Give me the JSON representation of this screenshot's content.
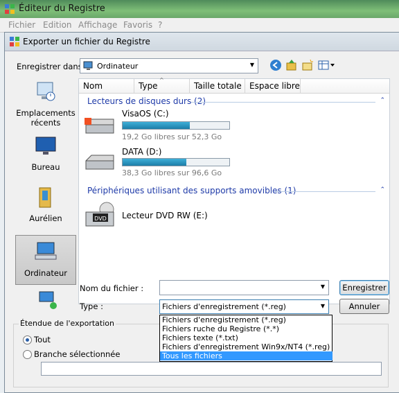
{
  "app": {
    "title": "Éditeur du Registre",
    "menu": [
      "Fichier",
      "Edition",
      "Affichage",
      "Favoris",
      "?"
    ]
  },
  "dialog": {
    "title": "Exporter un fichier du Registre",
    "save_in_label": "Enregistrer dans :",
    "save_in_value": "Ordinateur",
    "places": [
      "Emplacements récents",
      "Bureau",
      "Aurélien",
      "Ordinateur"
    ],
    "selected_place": "Ordinateur",
    "columns": [
      "Nom",
      "Type",
      "Taille totale",
      "Espace libre"
    ],
    "groups": [
      {
        "title": "Lecteurs de disques durs (2)",
        "items": [
          {
            "name": "VisaOS (C:)",
            "detail": "19,2 Go libres sur 52,3 Go",
            "used_fraction": 0.63
          },
          {
            "name": "DATA (D:)",
            "detail": "38,3 Go libres sur 96,6 Go",
            "used_fraction": 0.6
          }
        ]
      },
      {
        "title": "Périphériques utilisant des supports amovibles (1)",
        "items": [
          {
            "name": "Lecteur DVD RW (E:)",
            "icon_text": "DVD"
          }
        ]
      }
    ],
    "filename_label": "Nom du fichier :",
    "filename_value": "",
    "type_label": "Type :",
    "type_value": "Fichiers d'enregistrement (*.reg)",
    "type_options": [
      "Fichiers d'enregistrement (*.reg)",
      "Fichiers ruche du Registre (*.*)",
      "Fichiers texte (*.txt)",
      "Fichiers d'enregistrement Win9x/NT4  (*.reg)",
      "Tous les fichiers"
    ],
    "highlighted_option": "Tous les fichiers",
    "save_button": "Enregistrer",
    "cancel_button": "Annuler",
    "export_range_label": "Étendue de l'exportation",
    "range_all": "Tout",
    "range_branch": "Branche sélectionnée",
    "branch_value": ""
  },
  "colors": {
    "accent": "#1e3aa8",
    "highlight": "#3399ff",
    "bar_fill": "#1c7ea8"
  }
}
